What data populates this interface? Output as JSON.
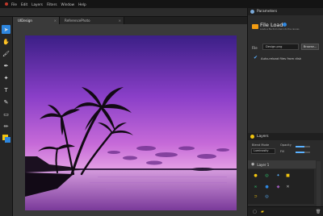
{
  "menubar": {
    "items": [
      "File",
      "Edit",
      "Layers",
      "Filters",
      "Window",
      "Help"
    ]
  },
  "tabs": [
    {
      "label": "UIDesign",
      "active": true
    },
    {
      "label": "ReferencePhoto",
      "active": false
    }
  ],
  "tools": [
    "pointer-icon",
    "hand-icon",
    "brush-icon",
    "pen-icon",
    "magic-wand-icon",
    "text-icon",
    "dropper-icon",
    "eraser-icon",
    "pencil-icon",
    "color-swatch-icon"
  ],
  "parameters": {
    "header": "Parameters",
    "title": "File Load",
    "desc": "Loads a file from disk into the canvas",
    "file_label": "File",
    "file_value": "Design.png",
    "browse_label": "Browse...",
    "autoreload_label": "Auto-reload files from disk",
    "autoreload_checked": true
  },
  "layers": {
    "header": "Layers",
    "blend_label": "Blend Mode",
    "blend_value": "Luminosity",
    "opacity_label": "Opacity",
    "fill_label": "Fill",
    "layer_name": "Layer 1"
  },
  "colors": {
    "accent": "#2e86de",
    "sky_top": "#4a2a9a",
    "sky_mid": "#b25ad8",
    "sky_low": "#e8a0e0"
  }
}
